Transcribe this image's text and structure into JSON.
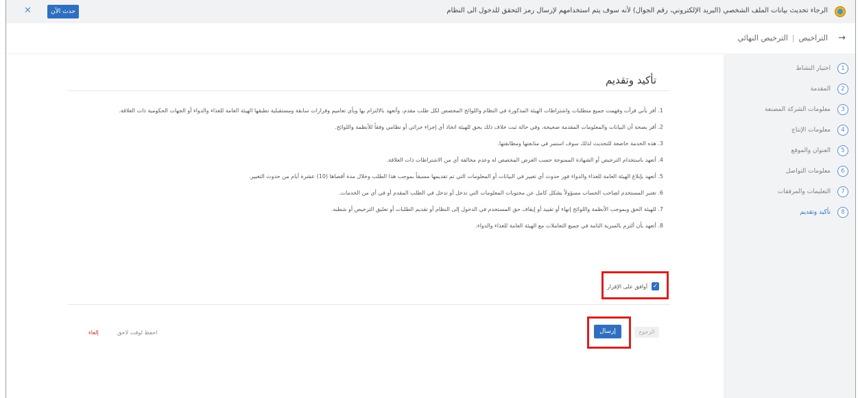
{
  "banner": {
    "text": "الرجاء تحديث بيانات الملف الشخصي (البريد الإلكتروني، رقم الجوال) لأنه سوف يتم استخدامهم لإرسال رمز التحقق للدخول الى النظام",
    "update_label": "حدث الآن",
    "close_label": "✕"
  },
  "breadcrumb": {
    "back_icon": "→",
    "items": [
      "التراخيص",
      "الترخيص النهائي"
    ],
    "separator": "|"
  },
  "steps": [
    {
      "num": "1",
      "label": "اختيار النشاط"
    },
    {
      "num": "2",
      "label": "المقدمة"
    },
    {
      "num": "3",
      "label": "معلومات الشركة المصنعة"
    },
    {
      "num": "4",
      "label": "معلومات الإنتاج"
    },
    {
      "num": "5",
      "label": "العنوان والموقع"
    },
    {
      "num": "6",
      "label": "معلومات التواصل"
    },
    {
      "num": "7",
      "label": "التعليمات والمرفقات"
    },
    {
      "num": "8",
      "label": "تأكيد وتقديم"
    }
  ],
  "main": {
    "title": "تأكيد وتقديم",
    "terms": [
      "1. أقر بأني قرأت وفهمت جميع متطلبات واشتراطات الهيئة المذكورة في النظام واللوائح المخصص لكل طلب مقدم، وأتعهد بالالتزام بها وبأي تعاميم وقرارات سابقة ومستقبلية تطبقها الهيئة العامة للغذاء والدواء أو الجهات الحكومية ذات العلاقة.",
      "2. أقر بصحة أن البيانات والمعلومات المقدمة صحيحة، وفي حالة ثبت خلاف ذلك يحق للهيئة اتخاذ أي إجراء جزائي أو نظامي وفقاً للأنظمة واللوائح.",
      "3. هذه الخدمة خاضعة للتحديث لذلك سوف استمر في متابعتها ومطابقتها.",
      "4. أتعهد باستخدام الترخيص أو الشهادة الممنوحة حسب الغرض المخصص له وعدم مخالفة أي من الاشتراطات ذات العلاقة.",
      "5. أتعهد بإبلاغ الهيئة العامة للغذاء والدواء فور حدوث أي تغيير في البيانات أو المعلومات التي تم تقديمها مسبقاً بموجب هذا الطلب وخلال مدة أقصاها (10) عشرة أيام من حدوث التغيير.",
      "6. تعتبر المستخدم لصاحب الحساب مسؤولاً بشكل كامل عن محتويات المعلومات التي تدخل أو تدخل في الطلب المقدم أو في أي من الخدمات.",
      "7. للهيئة الحق وبموجب الأنظمة واللوائح إنهاء أو تقييد أو إيقاف حق المستخدم في الدخول إلى النظام أو تقديم الطلبات أو تعليق الترخيص أو شطبه.",
      "8. أتعهد بأن ألتزم بالسرية التامة في جميع التعاملات مع الهيئة العامة للغذاء والدواء."
    ],
    "agree_label": "أوافق على الإقرار",
    "agree_checked": "✓",
    "send_label": "إرسال",
    "back_label": "الرجوع",
    "save_label": "احفظ لوقت لاحق",
    "cancel_label": "إلغاء"
  }
}
